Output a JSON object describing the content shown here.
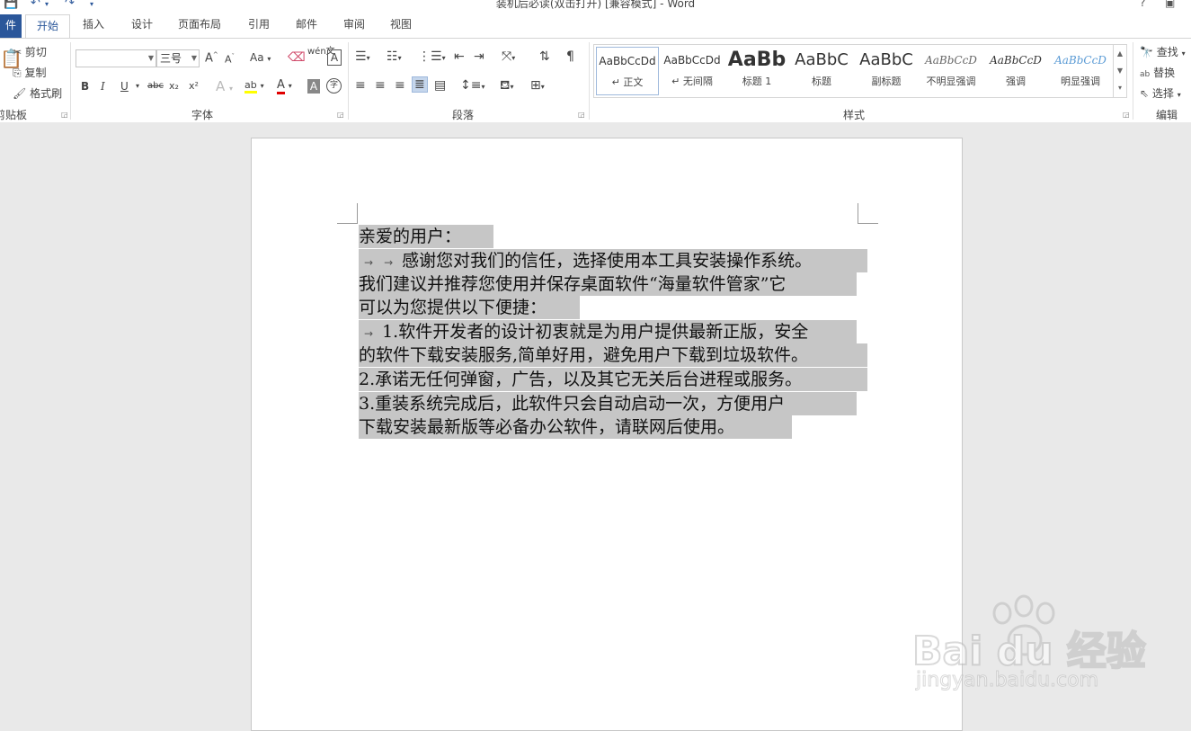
{
  "window": {
    "title": "装机后必读(双击打开) [兼容模式] - Word",
    "help_label": "?",
    "restore_label": "▣"
  },
  "tabs": [
    "开始",
    "插入",
    "设计",
    "页面布局",
    "引用",
    "邮件",
    "审阅",
    "视图"
  ],
  "file_tab": "件",
  "clipboard": {
    "cut": "剪切",
    "copy": "复制",
    "format_painter": "格式刷",
    "group_label": "剪贴板"
  },
  "font": {
    "font_name": "",
    "font_size": "三号",
    "grow_label": "A",
    "shrink_label": "A",
    "case_label": "Aa",
    "bold": "B",
    "italic": "I",
    "underline": "U",
    "strike": "abc",
    "sub": "x₂",
    "sup": "x²",
    "phonetic": "wén文",
    "border_char": "A",
    "effects": "A",
    "highlight": "ab",
    "font_color": "A",
    "shading": "A",
    "enclose": "字",
    "group_label": "字体"
  },
  "paragraph": {
    "group_label": "段落"
  },
  "styles": {
    "items": [
      {
        "preview": "AaBbCcDd",
        "name": "↵ 正文"
      },
      {
        "preview": "AaBbCcDd",
        "name": "↵ 无间隔"
      },
      {
        "preview": "AaBb",
        "name": "标题 1"
      },
      {
        "preview": "AaBbC",
        "name": "标题"
      },
      {
        "preview": "AaBbC",
        "name": "副标题"
      },
      {
        "preview": "AaBbCcD",
        "name": "不明显强调"
      },
      {
        "preview": "AaBbCcD",
        "name": "强调"
      },
      {
        "preview": "AaBbCcD",
        "name": "明显强调"
      }
    ],
    "group_label": "样式"
  },
  "editing": {
    "find": "查找",
    "replace": "替换",
    "select": "选择",
    "group_label": "编辑"
  },
  "document": {
    "lines": [
      " 亲爱的用户：",
      "感谢您对我们的信任，选择使用本工具安装操作系统。",
      "我们建议并推荐您使用并保存桌面软件“海量软件管家”它",
      "可以为您提供以下便捷：",
      "1.软件开发者的设计初衷就是为用户提供最新正版，安全",
      "的软件下载安装服务,简单好用，避免用户下载到垃圾软件。",
      "    2.承诺无任何弹窗，广告，以及其它无关后台进程或服务。",
      "    3.重装系统完成后，此软件只会自动启动一次，方便用户",
      "下载安装最新版等必备办公软件，请联网后使用。"
    ],
    "tab_arrow": "→"
  },
  "watermark": {
    "brand": "Bai du 经验",
    "url": "jingyan.baidu.com"
  },
  "colors": {
    "accent": "#2b579a",
    "selection": "#c6c6c6",
    "highlight_yellow": "#ffff00",
    "font_red": "#e00000"
  }
}
